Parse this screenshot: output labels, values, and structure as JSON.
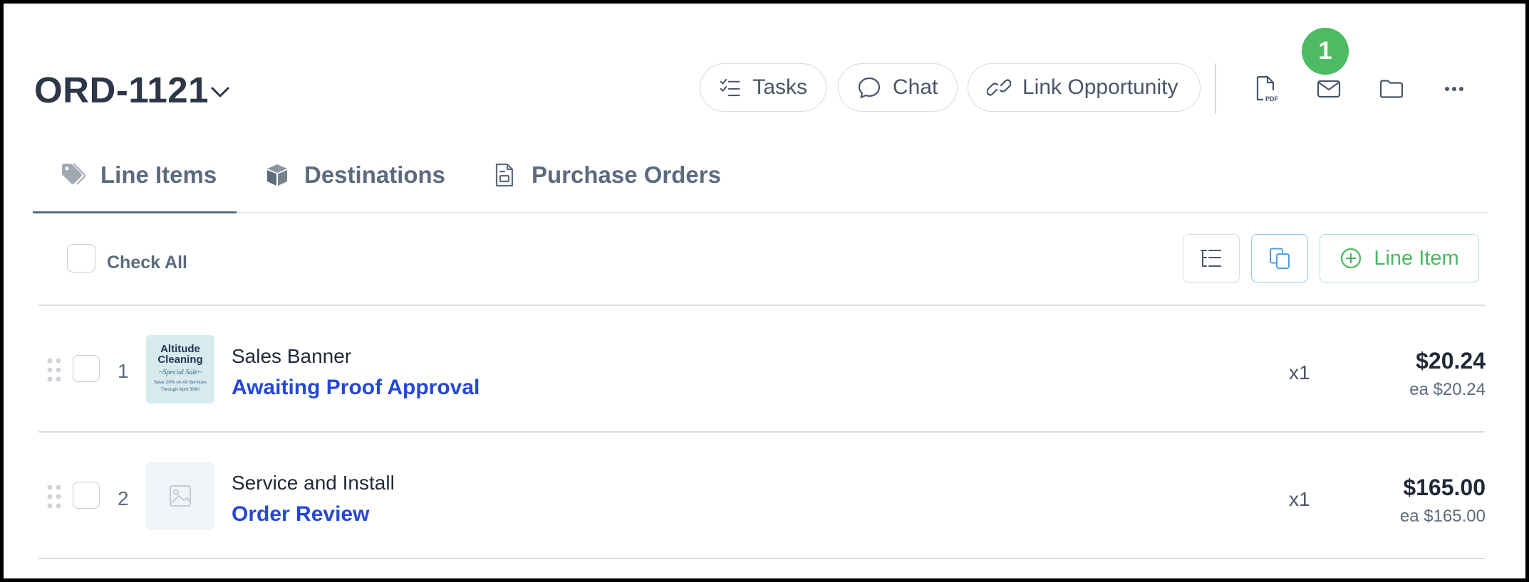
{
  "header": {
    "order_id": "ORD-1121",
    "buttons": {
      "tasks": "Tasks",
      "chat": "Chat",
      "link_opportunity": "Link Opportunity"
    },
    "notification_count": "1",
    "icons": [
      "pdf-icon",
      "mail-icon",
      "folder-icon",
      "more-icon"
    ]
  },
  "tabs": [
    {
      "label": "Line Items",
      "icon": "tag-icon",
      "active": true
    },
    {
      "label": "Destinations",
      "icon": "box-icon",
      "active": false
    },
    {
      "label": "Purchase Orders",
      "icon": "document-icon",
      "active": false
    }
  ],
  "toolbar": {
    "check_all": "Check All",
    "add_line_item": "Line Item"
  },
  "line_items": [
    {
      "number": "1",
      "name": "Sales Banner",
      "status": "Awaiting Proof Approval",
      "quantity": "x1",
      "total": "$20.24",
      "each": "ea $20.24",
      "thumbnail": {
        "line1": "Altitude",
        "line2": "Cleaning",
        "line3": "~Special Sale~",
        "line4": "Save 20% on All Services",
        "line5": "Through April 30th!"
      }
    },
    {
      "number": "2",
      "name": "Service and Install",
      "status": "Order Review",
      "quantity": "x1",
      "total": "$165.00",
      "each": "ea $165.00",
      "thumbnail": null
    }
  ],
  "colors": {
    "title": "#2d3748",
    "status_link": "#2548d4",
    "badge": "#4cbb64",
    "line_item_button": "#48b860",
    "copy_button_border": "#8ec5ef"
  }
}
